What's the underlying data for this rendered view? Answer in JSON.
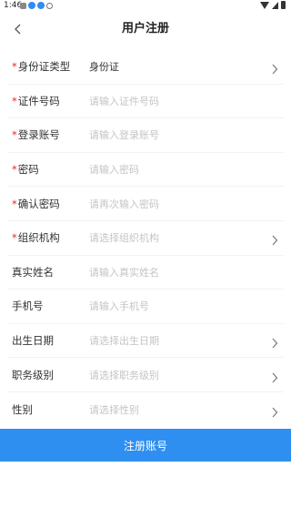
{
  "status_bar": {
    "time": "1:46"
  },
  "header": {
    "title": "用户注册",
    "back_icon": "chevron-left-icon"
  },
  "form": {
    "fields": [
      {
        "label": "身份证类型",
        "required": true,
        "value": "身份证",
        "placeholder": "",
        "chevron": true
      },
      {
        "label": "证件号码",
        "required": true,
        "value": "",
        "placeholder": "请输入证件号码",
        "chevron": false
      },
      {
        "label": "登录账号",
        "required": true,
        "value": "",
        "placeholder": "请输入登录账号",
        "chevron": false
      },
      {
        "label": "密码",
        "required": true,
        "value": "",
        "placeholder": "请输入密码",
        "chevron": false
      },
      {
        "label": "确认密码",
        "required": true,
        "value": "",
        "placeholder": "请再次输入密码",
        "chevron": false
      },
      {
        "label": "组织机构",
        "required": true,
        "value": "",
        "placeholder": "请选择组织机构",
        "chevron": true
      },
      {
        "label": "真实姓名",
        "required": false,
        "value": "",
        "placeholder": "请输入真实姓名",
        "chevron": false
      },
      {
        "label": "手机号",
        "required": false,
        "value": "",
        "placeholder": "请输入手机号",
        "chevron": false
      },
      {
        "label": "出生日期",
        "required": false,
        "value": "",
        "placeholder": "请选择出生日期",
        "chevron": true
      },
      {
        "label": "职务级别",
        "required": false,
        "value": "",
        "placeholder": "请选择职务级别",
        "chevron": true
      },
      {
        "label": "性别",
        "required": false,
        "value": "",
        "placeholder": "请选择性别",
        "chevron": true
      }
    ],
    "required_mark": "*"
  },
  "submit": {
    "label": "注册账号"
  },
  "colors": {
    "accent": "#2e8ff0",
    "required": "#e02a2a",
    "placeholder": "#c4c4c4"
  }
}
